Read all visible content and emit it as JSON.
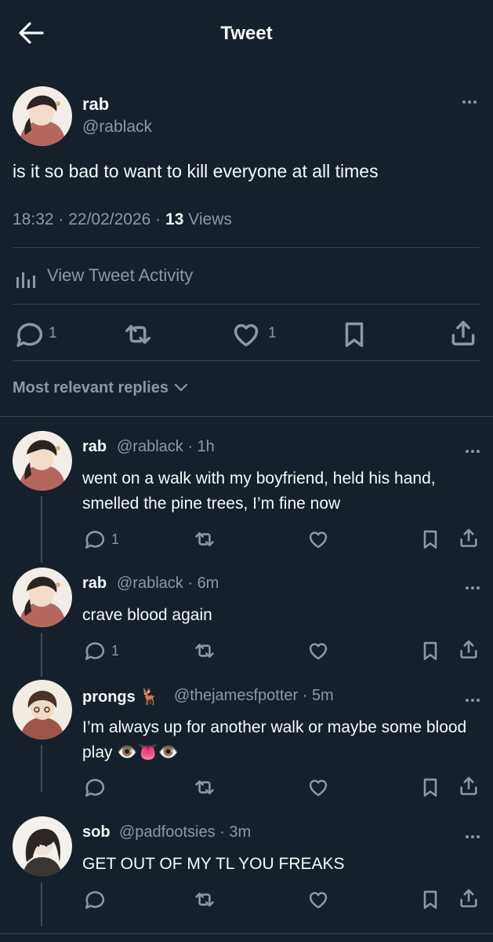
{
  "header": {
    "title": "Tweet",
    "back_icon": "arrow-left-icon"
  },
  "main_tweet": {
    "name": "rab",
    "handle": "@rablack",
    "text": "is it so bad to want to kill everyone at all times",
    "time": "18:32",
    "date": "22/02/2026",
    "views_count": "13",
    "views_label": "Views",
    "activity_label": "View Tweet Activity",
    "replies_count": "1",
    "likes_count": "1"
  },
  "sort": {
    "label": "Most relevant replies"
  },
  "replies": [
    {
      "name": "rab",
      "handle": "@rablack",
      "time": "1h",
      "text": "went on a walk with my boyfriend, held his hand, smelled the pine trees, I’m fine now",
      "reply_count": "1"
    },
    {
      "name": "rab",
      "handle": "@rablack",
      "time": "6m",
      "text": "crave blood again",
      "reply_count": "1"
    },
    {
      "name": "prongs",
      "name_emoji": "🦌",
      "handle": "@thejamesfpotter",
      "time": "5m",
      "text": "I’m always up for another walk or maybe some blood play 👁️👅👁️",
      "reply_count": ""
    },
    {
      "name": "sob",
      "handle": "@padfootsies",
      "time": "3m",
      "text": "GET OUT OF MY TL YOU FREAKS",
      "reply_count": ""
    }
  ],
  "colors": {
    "background": "#15202b",
    "text": "#f7f9f9",
    "muted": "#8b98a5",
    "divider": "#38444d"
  }
}
